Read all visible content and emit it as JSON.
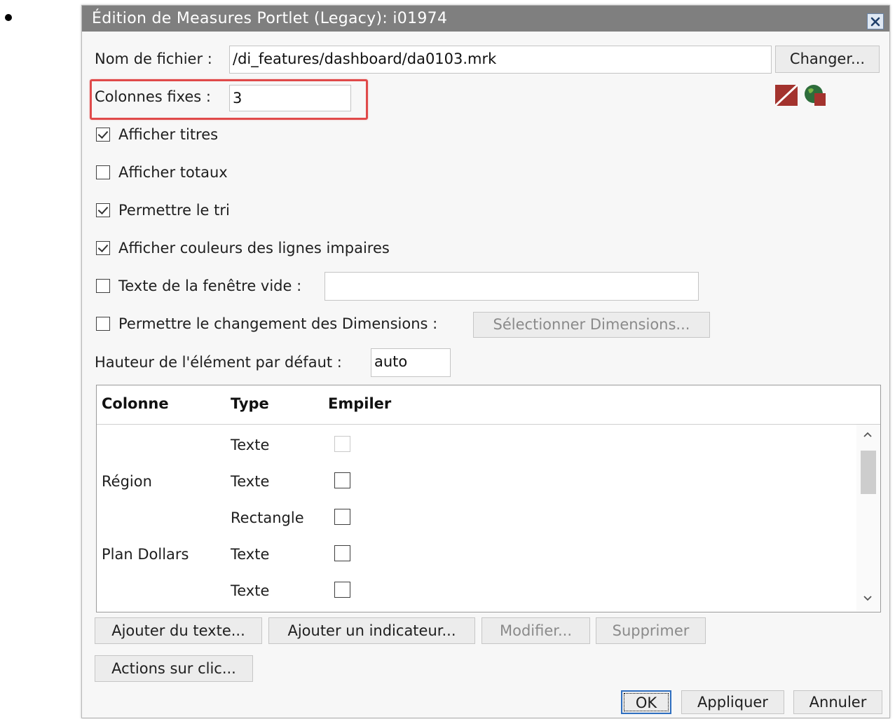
{
  "dialog": {
    "title": "Édition de Measures Portlet (Legacy): i01974"
  },
  "file": {
    "label": "Nom de fichier :",
    "value": "/di_features/dashboard/da0103.mrk",
    "change_button": "Changer..."
  },
  "fixed_columns": {
    "label": "Colonnes fixes :",
    "value": "3"
  },
  "options": {
    "show_titles": {
      "label": "Afficher titres",
      "checked": true
    },
    "show_totals": {
      "label": "Afficher totaux",
      "checked": false
    },
    "allow_sort": {
      "label": "Permettre le tri",
      "checked": true
    },
    "odd_row_colors": {
      "label": "Afficher couleurs des lignes impaires",
      "checked": true
    },
    "empty_window_text": {
      "label": "Texte de la fenêtre vide :",
      "checked": false,
      "value": ""
    },
    "dimension_change": {
      "label": "Permettre le changement des Dimensions :",
      "checked": false,
      "button": "Sélectionner Dimensions..."
    }
  },
  "default_height": {
    "label": "Hauteur de l'élément par défaut :",
    "value": "auto"
  },
  "table": {
    "headers": {
      "column": "Colonne",
      "type": "Type",
      "stack": "Empiler"
    },
    "rows": [
      {
        "column": "",
        "type": "Texte",
        "stack": false,
        "disabled": true
      },
      {
        "column": "Région",
        "type": "Texte",
        "stack": false,
        "disabled": false
      },
      {
        "column": "",
        "type": "Rectangle",
        "stack": false,
        "disabled": false
      },
      {
        "column": "Plan Dollars",
        "type": "Texte",
        "stack": false,
        "disabled": false
      },
      {
        "column": "",
        "type": "Texte",
        "stack": false,
        "disabled": false
      }
    ]
  },
  "buttons": {
    "add_text": "Ajouter du texte...",
    "add_indicator": "Ajouter un indicateur...",
    "modify": "Modifier...",
    "delete": "Supprimer",
    "click_actions": "Actions sur clic...",
    "ok": "OK",
    "apply": "Appliquer",
    "cancel": "Annuler"
  },
  "colors": {
    "titlebar": "#7f7f7f",
    "highlight": "#e04a4a",
    "ok_border": "#2f6fc0"
  }
}
